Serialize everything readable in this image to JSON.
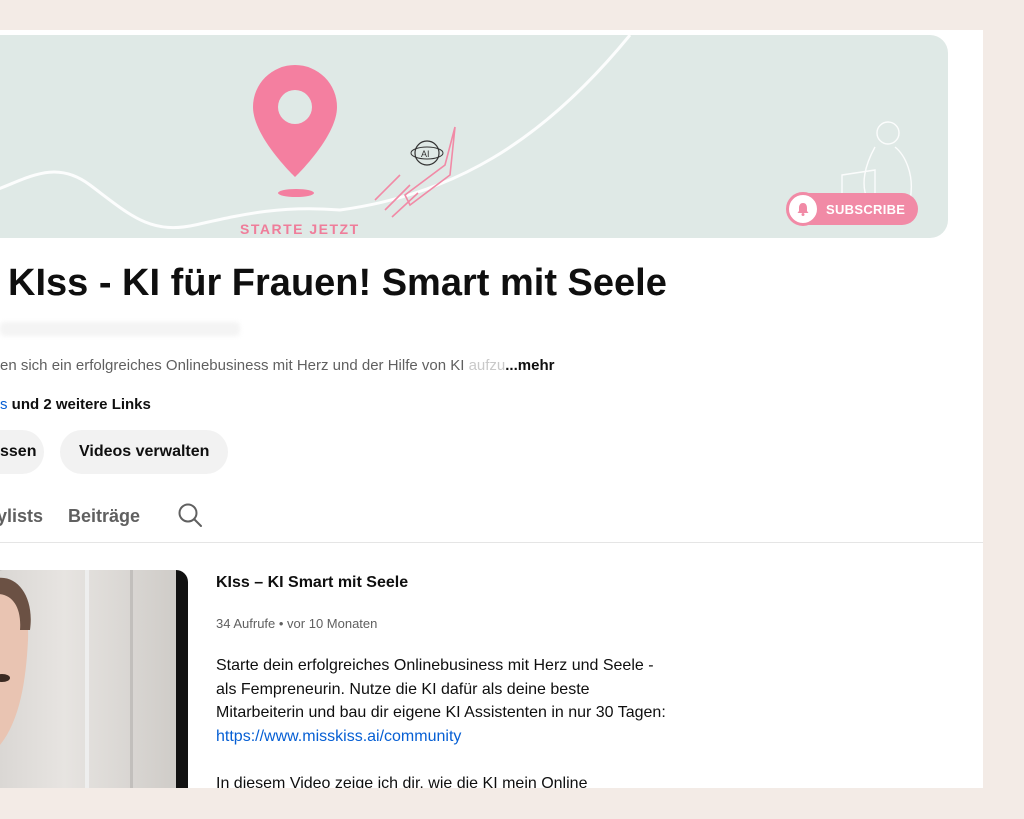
{
  "banner": {
    "cta": "STARTE JETZT",
    "subscribe_label": "SUBSCRIBE",
    "colors": {
      "background": "#dfe9e6",
      "accent_pink": "#f18aa6",
      "pin_pink": "#f47fa0"
    }
  },
  "channel": {
    "title": "KIss - KI für Frauen! Smart mit Seele",
    "description": "en sich ein erfolgreiches Onlinebusiness mit Herz und der Hilfe von KI ",
    "description_fade": "aufzu",
    "more_label": "...mehr",
    "links_prefix": "s",
    "links_rest": " und 2 weitere Links"
  },
  "buttons": {
    "customize_label": "ssen",
    "manage_videos_label": "Videos verwalten"
  },
  "tabs": {
    "playlists_label": "ylists",
    "posts_label": "Beiträge",
    "search_icon": "search-icon"
  },
  "video": {
    "title": "KIss – KI Smart mit Seele",
    "meta": "34 Aufrufe • vor 10 Monaten",
    "desc_line1": "Starte dein erfolgreiches Onlinebusiness mit Herz und Seele -",
    "desc_line2": "als Fempreneurin. Nutze die KI dafür als deine beste",
    "desc_line3": "Mitarbeiterin und bau dir eigene KI Assistenten in nur 30 Tagen:",
    "desc_url": "https://www.misskiss.ai/community",
    "desc_line5": "In diesem Video zeige ich dir, wie die KI mein Online"
  }
}
